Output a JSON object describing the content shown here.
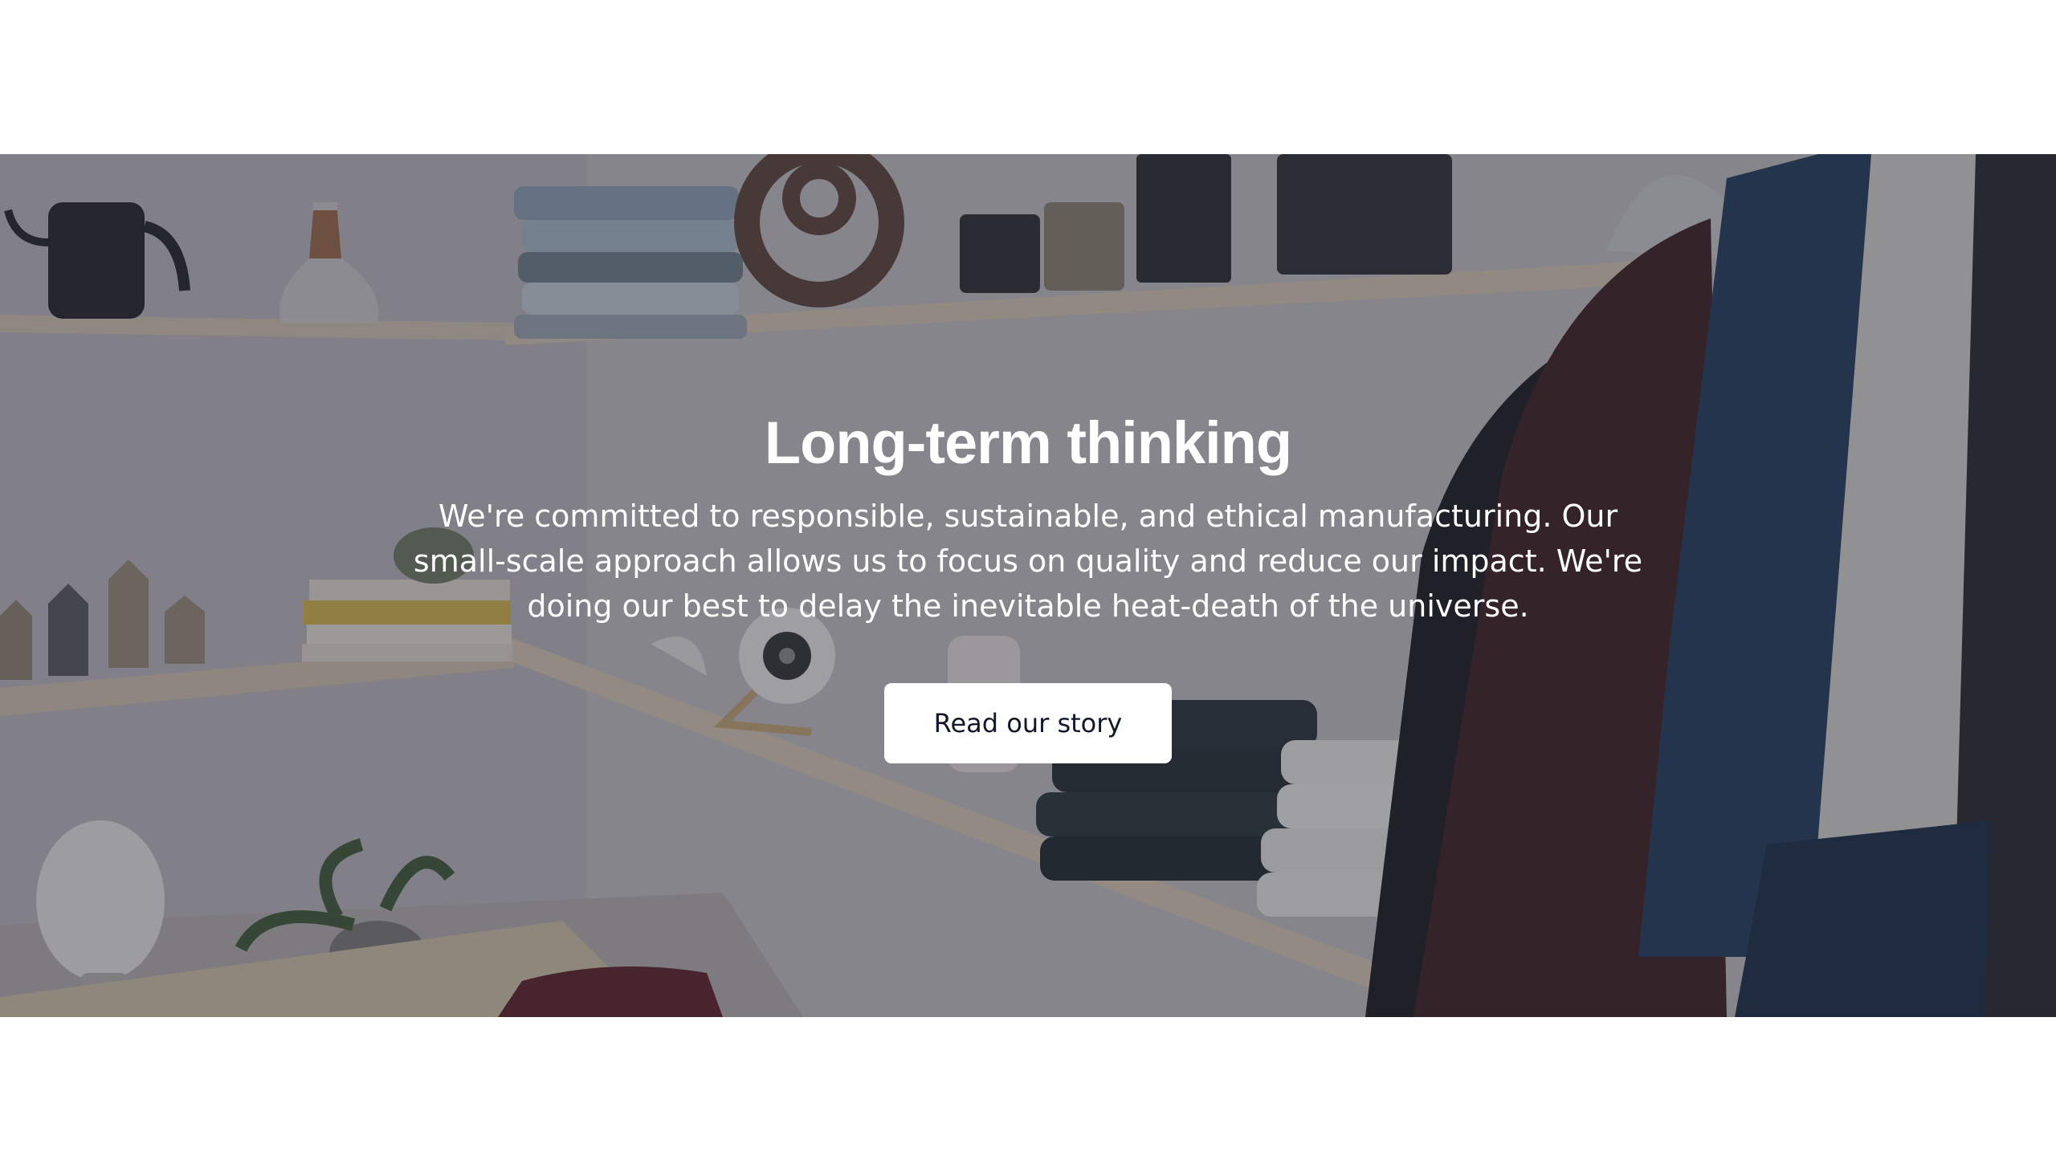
{
  "hero": {
    "title": "Long-term thinking",
    "description": "We're committed to responsible, sustainable, and ethical manufacturing. Our small-scale approach allows us to focus on quality and reduce our impact. We're doing our best to delay the inevitable heat-death of the universe.",
    "button_label": "Read our story",
    "image_subject": "store shelves with folded clothing, kettle, speaker, and hanging garments"
  },
  "colors": {
    "page_background": "#ffffff",
    "overlay": "#2d2d3a",
    "title_text": "#ffffff",
    "button_background": "#ffffff",
    "button_text": "#111827"
  }
}
